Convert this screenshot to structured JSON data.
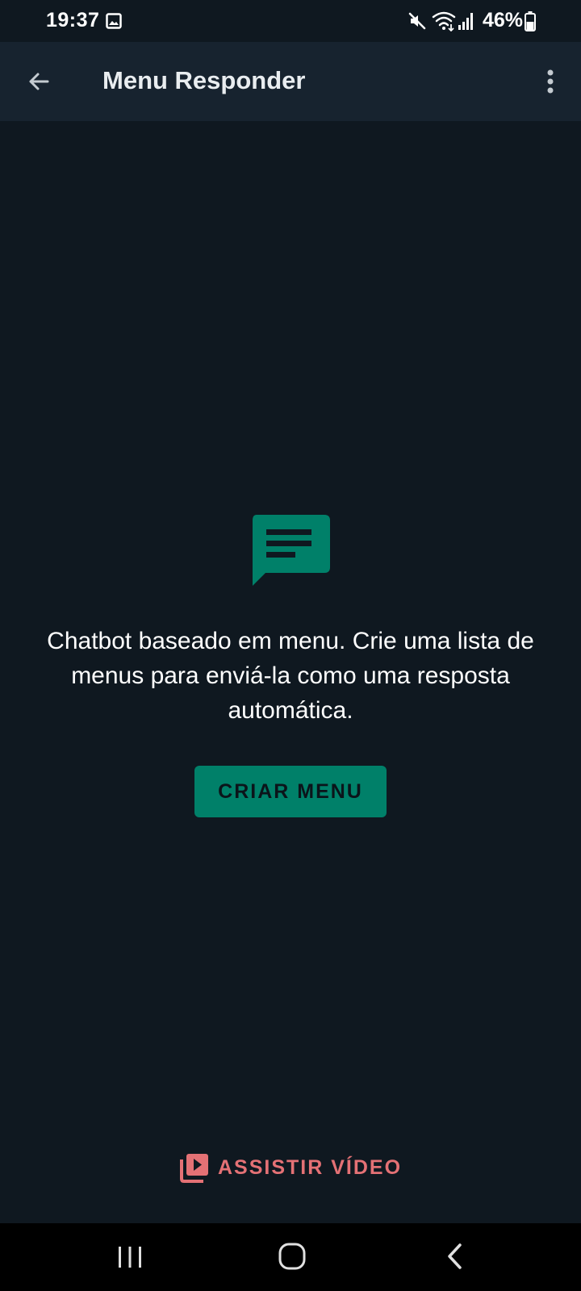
{
  "status_bar": {
    "time": "19:37",
    "battery": "46%",
    "icons": [
      "gallery-icon",
      "mute-icon",
      "wifi-icon",
      "signal-icon",
      "battery-icon"
    ]
  },
  "app_bar": {
    "title": "Menu Responder",
    "back_icon": "arrow-back-icon",
    "more_icon": "more-vert-icon",
    "background": "#17232f"
  },
  "empty_state": {
    "icon": "chat-message-icon",
    "description": "Chatbot baseado em menu. Crie uma lista de menus para enviá-la como uma resposta automática.",
    "button_label": "CRIAR MENU",
    "accent_color": "#008069"
  },
  "watch_video": {
    "label": "ASSISTIR VÍDEO",
    "icon": "video-library-icon",
    "color": "#e47175"
  },
  "navigation": {
    "items": [
      "recents-icon",
      "home-icon",
      "back-icon"
    ]
  },
  "colors": {
    "background": "#0f1820",
    "text": "#ffffff"
  }
}
